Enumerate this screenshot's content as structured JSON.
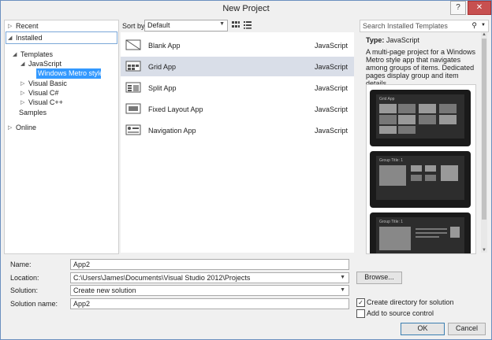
{
  "window": {
    "title": "New Project",
    "help_label": "?",
    "close_label": "✕"
  },
  "tree": {
    "recent": "Recent",
    "installed": "Installed",
    "templates": "Templates",
    "javascript": "JavaScript",
    "windows_metro": "Windows Metro style",
    "visual_basic": "Visual Basic",
    "visual_csharp": "Visual C#",
    "visual_cpp": "Visual C++",
    "samples": "Samples",
    "online": "Online"
  },
  "toolbar": {
    "sort_label": "Sort by:",
    "sort_value": "Default",
    "search_placeholder": "Search Installed Templates"
  },
  "templates": [
    {
      "name": "Blank App",
      "language": "JavaScript",
      "icon": "blank-app-icon"
    },
    {
      "name": "Grid App",
      "language": "JavaScript",
      "icon": "grid-app-icon"
    },
    {
      "name": "Split App",
      "language": "JavaScript",
      "icon": "split-app-icon"
    },
    {
      "name": "Fixed Layout App",
      "language": "JavaScript",
      "icon": "fixed-layout-app-icon"
    },
    {
      "name": "Navigation App",
      "language": "JavaScript",
      "icon": "navigation-app-icon"
    }
  ],
  "details": {
    "type_label": "Type:",
    "type_value": "JavaScript",
    "description": "A multi-page project for a Windows Metro style app that navigates among groups of items. Dedicated pages display group and item details.",
    "preview_texts": [
      "Grid App",
      "Group Title: 1",
      "Group Title: 1"
    ]
  },
  "form": {
    "name_label": "Name:",
    "name_value": "App2",
    "location_label": "Location:",
    "location_value": "C:\\Users\\James\\Documents\\Visual Studio 2012\\Projects",
    "solution_label": "Solution:",
    "solution_value": "Create new solution",
    "solution_name_label": "Solution name:",
    "solution_name_value": "App2",
    "browse_label": "Browse...",
    "create_dir_label": "Create directory for solution",
    "create_dir_checked": true,
    "source_control_label": "Add to source control",
    "source_control_checked": false,
    "ok_label": "OK",
    "cancel_label": "Cancel"
  },
  "colors": {
    "selection": "#3399ff",
    "close": "#c75050",
    "row_highlight": "#d9dee8"
  }
}
